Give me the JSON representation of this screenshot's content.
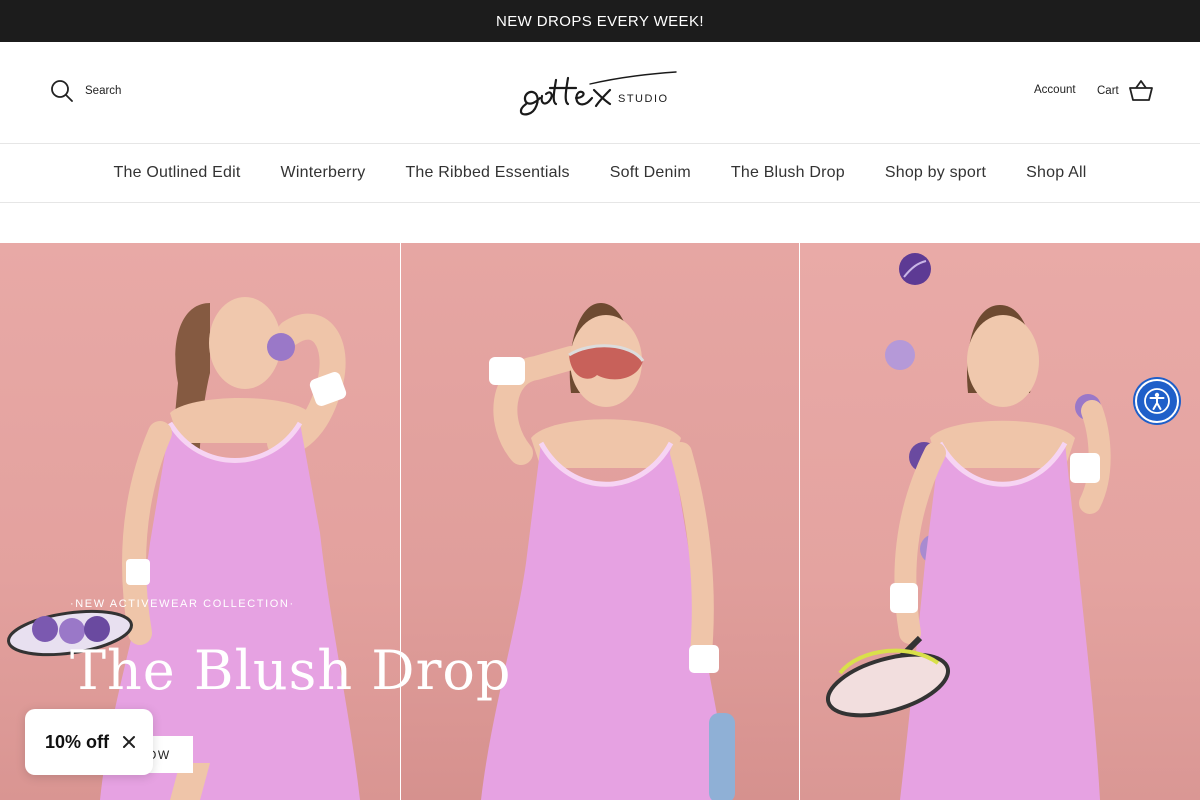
{
  "announcement": {
    "text": "NEW DROPS EVERY WEEK!"
  },
  "header": {
    "search_label": "Search",
    "logo_script": "gottex",
    "logo_sub": "STUDIO",
    "account_label": "Account",
    "cart_label": "Cart"
  },
  "nav": {
    "items": [
      {
        "label": "The Outlined Edit"
      },
      {
        "label": "Winterberry"
      },
      {
        "label": "The Ribbed Essentials"
      },
      {
        "label": "Soft Denim"
      },
      {
        "label": "The Blush Drop"
      },
      {
        "label": "Shop by sport"
      },
      {
        "label": "Shop All"
      }
    ]
  },
  "hero": {
    "eyebrow": "·NEW ACTIVEWEAR COLLECTION·",
    "title": "The Blush Drop",
    "button_label": "SHOP NOW"
  },
  "discount_popup": {
    "text": "10% off"
  },
  "colors": {
    "announcement_bg": "#1c1c1c",
    "hero_bg": "#e3a19e",
    "dress_pink": "#e6a2e2",
    "tennis_ball": "#8c6bc0",
    "accessibility_blue": "#1f5fc9"
  }
}
